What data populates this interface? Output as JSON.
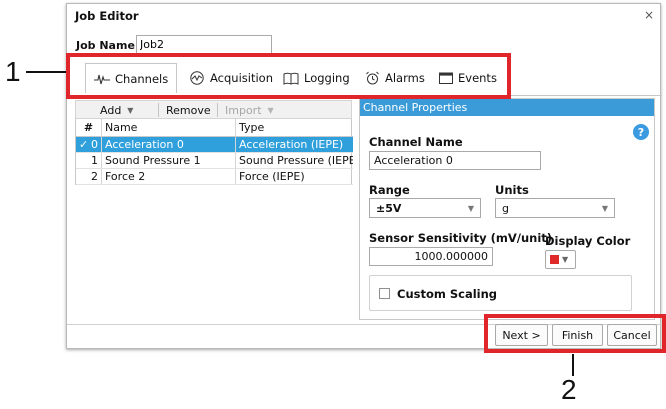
{
  "window": {
    "title": "Job Editor",
    "close_glyph": "×"
  },
  "job_name": {
    "label": "Job Name",
    "value": "Job2"
  },
  "tabs": [
    {
      "label": "Channels",
      "icon": "waveform-icon",
      "active": true
    },
    {
      "label": "Acquisition",
      "icon": "acquisition-icon",
      "active": false
    },
    {
      "label": "Logging",
      "icon": "book-icon",
      "active": false
    },
    {
      "label": "Alarms",
      "icon": "alarm-clock-icon",
      "active": false
    },
    {
      "label": "Events",
      "icon": "calendar-icon",
      "active": false
    }
  ],
  "toolbar": {
    "add_label": "Add",
    "remove_label": "Remove",
    "import_label": "Import"
  },
  "channel_table": {
    "headers": [
      "#",
      "Name",
      "Type"
    ],
    "rows": [
      {
        "check": "✓",
        "num": "0",
        "name": "Acceleration 0",
        "type": "Acceleration (IEPE)",
        "selected": true
      },
      {
        "check": "",
        "num": "1",
        "name": "Sound Pressure 1",
        "type": "Sound Pressure (IEPE)",
        "selected": false
      },
      {
        "check": "",
        "num": "2",
        "name": "Force 2",
        "type": "Force (IEPE)",
        "selected": false
      }
    ]
  },
  "channel_properties": {
    "header": "Channel Properties",
    "help_glyph": "?",
    "channel_name_label": "Channel Name",
    "channel_name_value": "Acceleration 0",
    "range_label": "Range",
    "range_value": "±5V",
    "units_label": "Units",
    "units_value": "g",
    "sensitivity_label": "Sensor Sensitivity (mV/unit)",
    "sensitivity_value": "1000.000000",
    "display_color_label": "Display Color",
    "display_color": "#e02a2a",
    "custom_scaling_label": "Custom Scaling"
  },
  "buttons": {
    "next_label": "Next >",
    "finish_label": "Finish",
    "cancel_label": "Cancel"
  },
  "callouts": [
    {
      "label": "1"
    },
    {
      "label": "2"
    }
  ],
  "colors": {
    "accent": "#2fa0dc",
    "header_blue": "#3a9bd8",
    "highlight_red": "#e0252b"
  }
}
